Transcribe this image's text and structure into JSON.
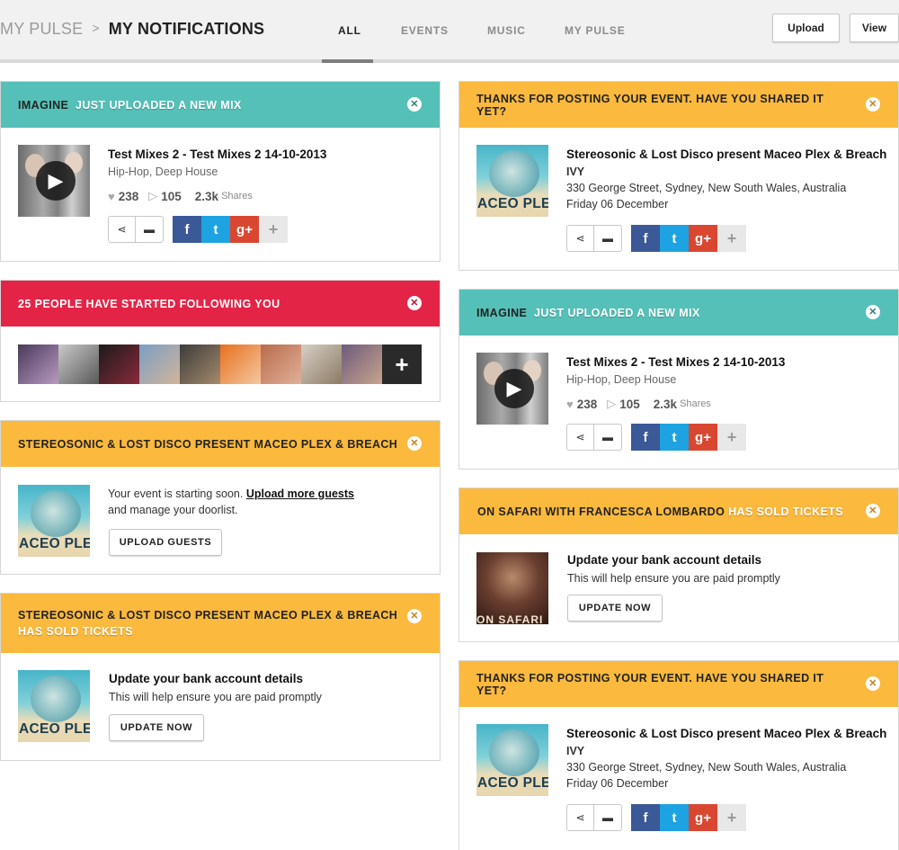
{
  "header": {
    "breadcrumb": [
      "MY PULSE",
      "MY NOTIFICATIONS"
    ],
    "breadcrumb_separator": ">",
    "tabs": [
      "ALL",
      "EVENTS",
      "MUSIC",
      "MY PULSE"
    ],
    "active_tab": "ALL",
    "buttons": {
      "upload": "Upload",
      "view": "View"
    }
  },
  "colors": {
    "teal": "#55c0b8",
    "orange": "#fbb93d",
    "red": "#e42446",
    "facebook": "#3b5897",
    "twitter": "#1da3e1",
    "google_plus": "#d94731"
  },
  "icons": {
    "close": "close-icon",
    "share": "share-icon",
    "comment": "comment-icon",
    "heart": "heart-icon",
    "play": "play-icon",
    "plus": "plus-icon"
  },
  "left": {
    "mix_upload": {
      "head_user": "IMAGINE",
      "head_action": "JUST UPLOADED A NEW MIX",
      "title": "Test Mixes 2 - Test Mixes 2 14-10-2013",
      "genres": "Hip-Hop, Deep House",
      "likes": "238",
      "plays": "105",
      "shares_count": "2.3k",
      "shares_label": "Shares"
    },
    "followers": {
      "head": "25 PEOPLE HAVE STARTED FOLLOWING YOU",
      "more": "+"
    },
    "event_guests": {
      "head": "STEREOSONIC & LOST DISCO PRESENT MACEO PLEX & BREACH",
      "thumb_label": "ACEO PLE",
      "text_line1": "Your event is starting soon.",
      "link": "Upload more guests",
      "text_line2": "and manage your doorlist.",
      "button": "UPLOAD GUESTS"
    },
    "event_sold": {
      "head_event": "STEREOSONIC & LOST DISCO PRESENT MACEO PLEX & BREACH",
      "head_action": "HAS SOLD TICKETS",
      "thumb_label": "ACEO PLE",
      "title": "Update your bank account details",
      "text": "This will help ensure you are paid promptly",
      "button": "UPDATE NOW"
    }
  },
  "right": {
    "event_posted_1": {
      "head": "THANKS FOR POSTING YOUR EVENT. HAVE YOU SHARED IT YET?",
      "thumb_label": "ACEO PLE",
      "title": "Stereosonic & Lost Disco present Maceo Plex & Breach",
      "venue": "IVY",
      "address": "330 George Street, Sydney, New South Wales, Australia",
      "date": "Friday 06 December"
    },
    "mix_upload": {
      "head_user": "IMAGINE",
      "head_action": "JUST UPLOADED A NEW MIX",
      "title": "Test Mixes 2 - Test Mixes 2 14-10-2013",
      "genres": "Hip-Hop, Deep House",
      "likes": "238",
      "plays": "105",
      "shares_count": "2.3k",
      "shares_label": "Shares"
    },
    "safari_sold": {
      "head_event": "ON SAFARI WITH FRANCESCA LOMBARDO",
      "head_action": "HAS SOLD TICKETS",
      "thumb_label": "ON SAFARI",
      "title": "Update your bank account details",
      "text": "This will help ensure you are paid promptly",
      "button": "UPDATE NOW"
    },
    "event_posted_2": {
      "head": "THANKS FOR POSTING YOUR EVENT. HAVE YOU SHARED IT YET?",
      "thumb_label": "ACEO PLE",
      "title": "Stereosonic & Lost Disco present Maceo Plex & Breach",
      "venue": "IVY",
      "address": "330 George Street, Sydney, New South Wales, Australia",
      "date": "Friday 06 December"
    }
  }
}
